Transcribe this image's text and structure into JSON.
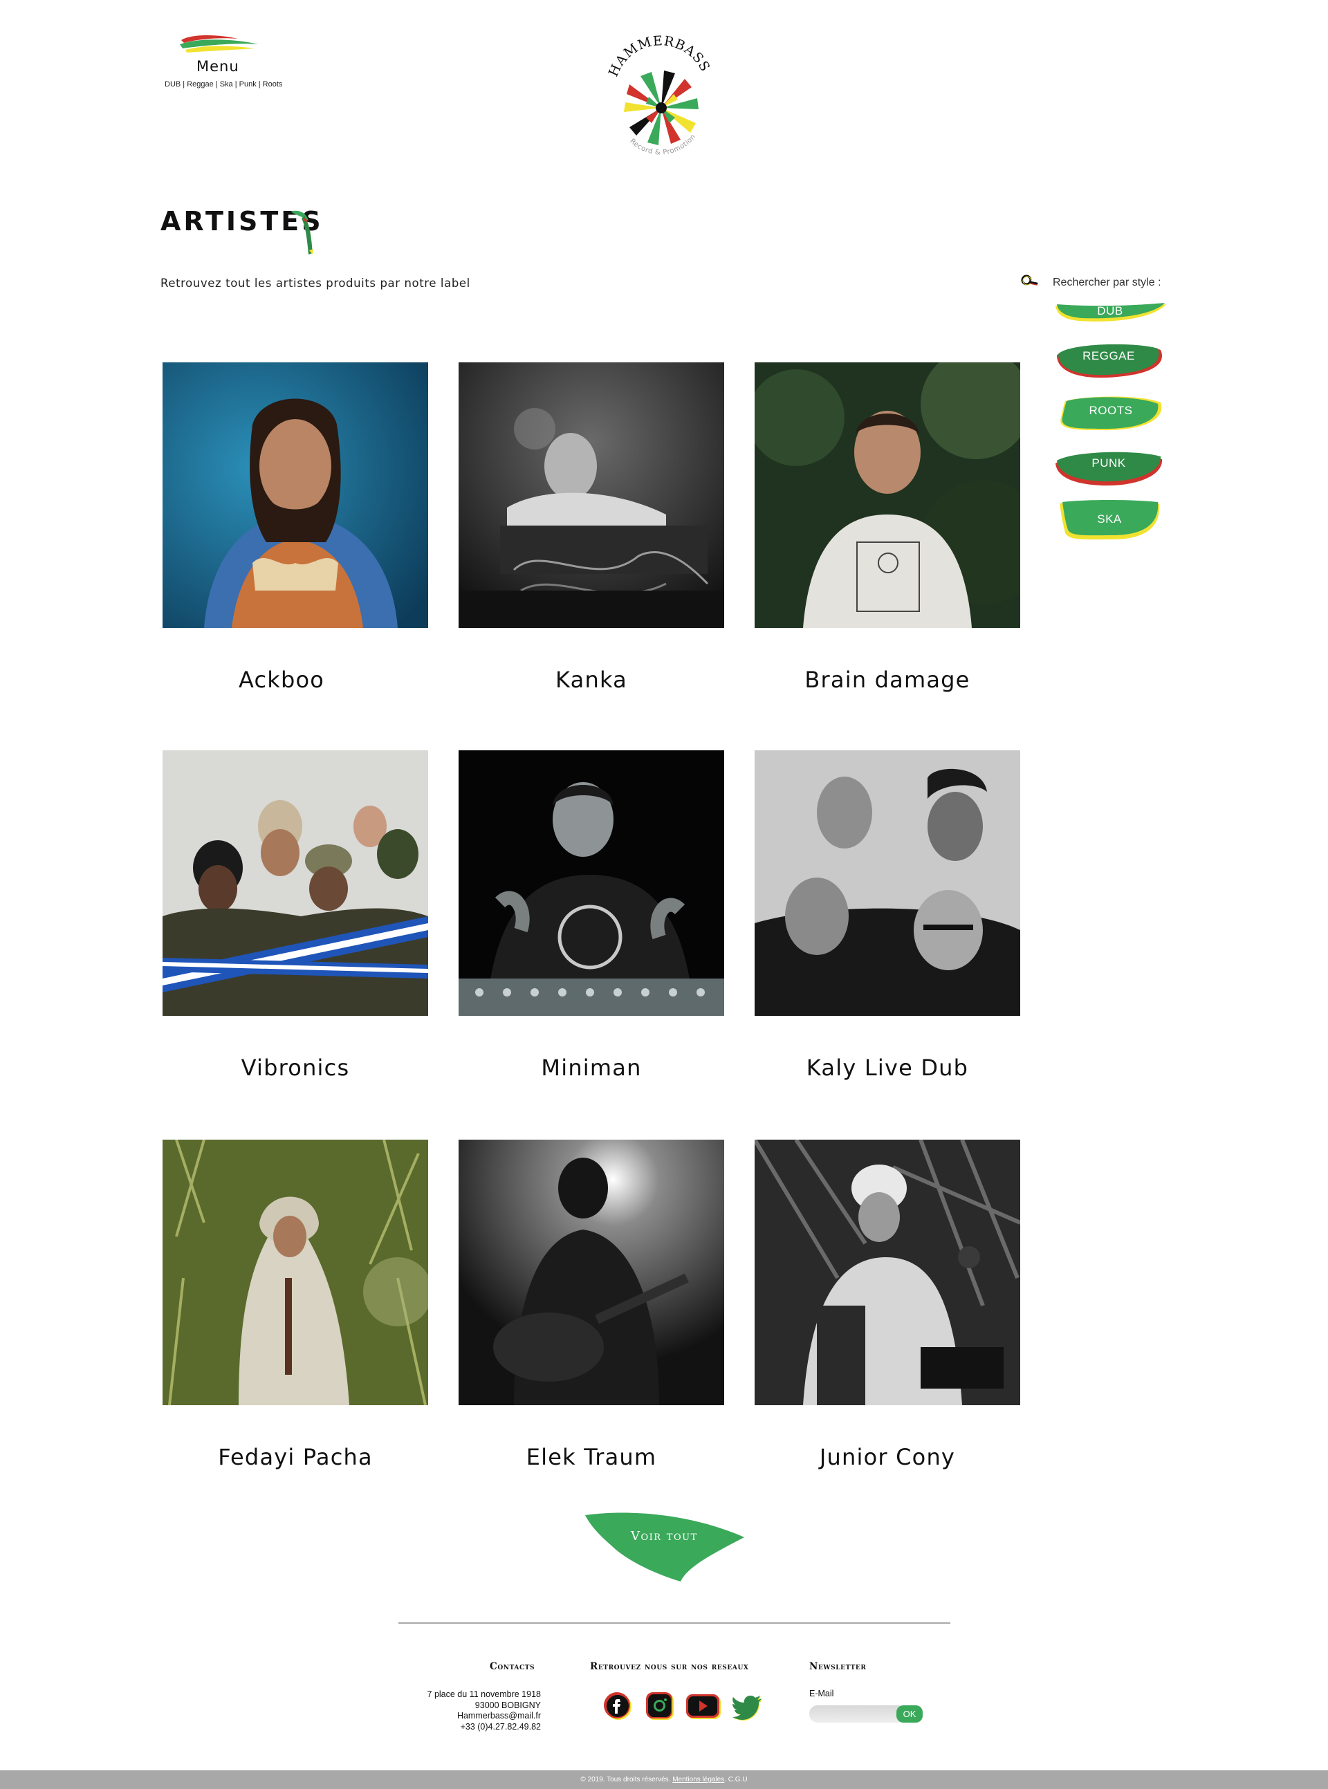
{
  "header": {
    "menu_label": "Menu",
    "menu_subtitle": "DUB | Reggae | Ska | Punk | Roots",
    "logo_text": "HAMMERBASS",
    "logo_tagline": "Record & Promotion"
  },
  "page": {
    "title": "ARTISTES",
    "subtitle": "Retrouvez tout les artistes produits par notre label"
  },
  "filter": {
    "label": "Rechercher par style :",
    "styles": [
      "DUB",
      "REGGAE",
      "ROOTS",
      "PUNK",
      "SKA"
    ]
  },
  "artists": [
    {
      "name": "Ackboo"
    },
    {
      "name": "Kanka"
    },
    {
      "name": "Brain damage"
    },
    {
      "name": "Vibronics"
    },
    {
      "name": "Miniman"
    },
    {
      "name": "Kaly Live Dub"
    },
    {
      "name": "Fedayi Pacha"
    },
    {
      "name": "Elek Traum"
    },
    {
      "name": "Junior Cony"
    }
  ],
  "voir_tout": "Voir tout",
  "footer": {
    "contacts_heading": "Contacts",
    "contact_lines": [
      "7 place du 11 novembre 1918",
      "93000 BOBIGNY",
      "Hammerbass@mail.fr",
      "+33 (0)4.27.82.49.82"
    ],
    "social_heading": "Retrouvez nous sur nos reseaux",
    "social_icons": [
      "facebook-icon",
      "instagram-icon",
      "youtube-icon",
      "twitter-icon"
    ],
    "newsletter_heading": "Newsletter",
    "email_label": "E-Mail",
    "email_placeholder": "",
    "ok_label": "OK"
  },
  "bottom_bar": {
    "copyright": "© 2019. Tous droits réservés.",
    "legal_link": "Mentions légales",
    "cgu": ". C.G.U"
  },
  "colors": {
    "green": "#3aa95a",
    "dark_green": "#2f8a47",
    "red": "#d0342c",
    "yellow": "#f2e230",
    "footer_bar": "#a8a8a8"
  }
}
